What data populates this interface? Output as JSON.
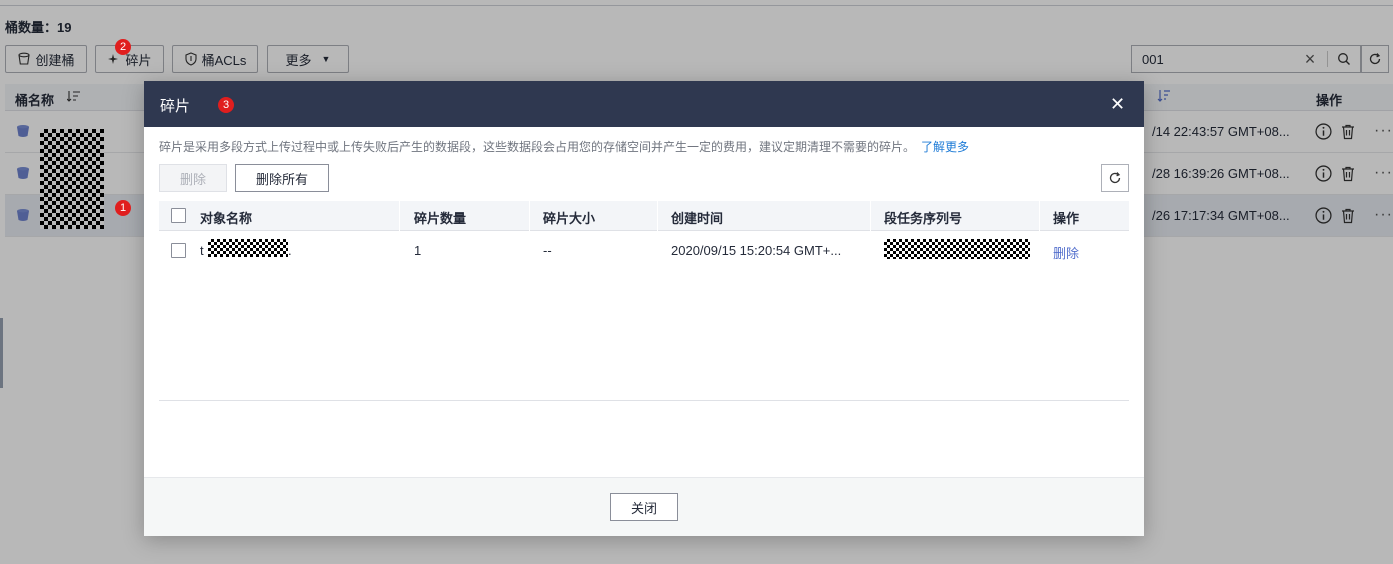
{
  "page": {
    "bucket_count_label": "桶数量：19",
    "toolbar": {
      "create_bucket": "创建桶",
      "fragments": "碎片",
      "bucket_acls": "桶ACLs",
      "more": "更多"
    },
    "search": {
      "value": "001"
    },
    "table_header": {
      "name": "桶名称",
      "operation": "操作"
    },
    "rows": [
      {
        "time": "/14 22:43:57 GMT+08..."
      },
      {
        "time": "/28 16:39:26 GMT+08..."
      },
      {
        "time": "/26 17:17:34 GMT+08..."
      }
    ],
    "badges": [
      "1",
      "2",
      "3"
    ]
  },
  "dialog": {
    "title": "碎片",
    "description": "碎片是采用多段方式上传过程中或上传失败后产生的数据段，这些数据段会占用您的存储空间并产生一定的费用，建议定期清理不需要的碎片。",
    "learn_more": "了解更多",
    "delete_button": "删除",
    "delete_all_button": "删除所有",
    "columns": [
      "对象名称",
      "碎片数量",
      "碎片大小",
      "创建时间",
      "段任务序列号",
      "操作"
    ],
    "rows": [
      {
        "object_name": "t",
        "object_suffix": ".",
        "count": "1",
        "size": "--",
        "created": "2020/09/15 15:20:54 GMT+...",
        "action": "删除"
      }
    ],
    "close_button": "关闭"
  },
  "colors": {
    "header": "#2f3850",
    "link": "#1e7bd6",
    "badge": "#e01e1e"
  }
}
